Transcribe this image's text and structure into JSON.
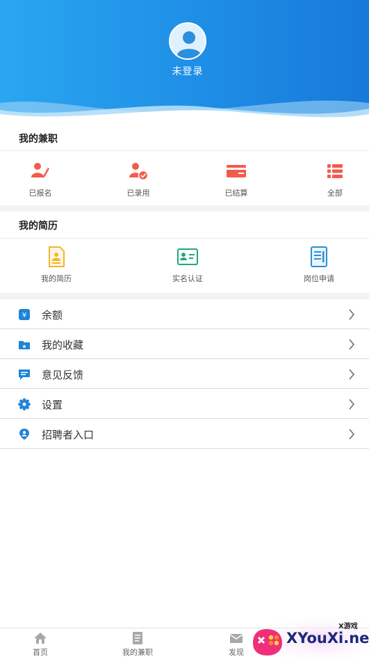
{
  "header": {
    "username": "未登录"
  },
  "jobs": {
    "title": "我的兼职",
    "items": [
      {
        "label": "已报名",
        "icon": "signed-up-icon"
      },
      {
        "label": "已录用",
        "icon": "hired-icon"
      },
      {
        "label": "已结算",
        "icon": "settled-card-icon"
      },
      {
        "label": "全部",
        "icon": "list-icon"
      }
    ],
    "accent": "#f25b4c"
  },
  "resume": {
    "title": "我的简历",
    "items": [
      {
        "label": "我的简历",
        "icon": "resume-doc-icon",
        "color": "#f5b42a"
      },
      {
        "label": "实名认证",
        "icon": "id-card-icon",
        "color": "#1fa87a"
      },
      {
        "label": "岗位申请",
        "icon": "application-doc-icon",
        "color": "#2a8fd8"
      }
    ]
  },
  "menu": [
    {
      "label": "余额",
      "icon": "wallet-icon"
    },
    {
      "label": "我的收藏",
      "icon": "favorite-folder-icon"
    },
    {
      "label": "意见反馈",
      "icon": "feedback-icon"
    },
    {
      "label": "设置",
      "icon": "settings-gear-icon"
    },
    {
      "label": "招聘者入口",
      "icon": "recruiter-location-icon"
    }
  ],
  "menu_icon_color": "#1e84d8",
  "tabbar": [
    {
      "label": "首页",
      "icon": "home-icon"
    },
    {
      "label": "我的兼职",
      "icon": "document-icon"
    },
    {
      "label": "发现",
      "icon": "mail-icon"
    }
  ],
  "watermark": {
    "brand": "XYouXi.net",
    "tag": "X游戏"
  }
}
